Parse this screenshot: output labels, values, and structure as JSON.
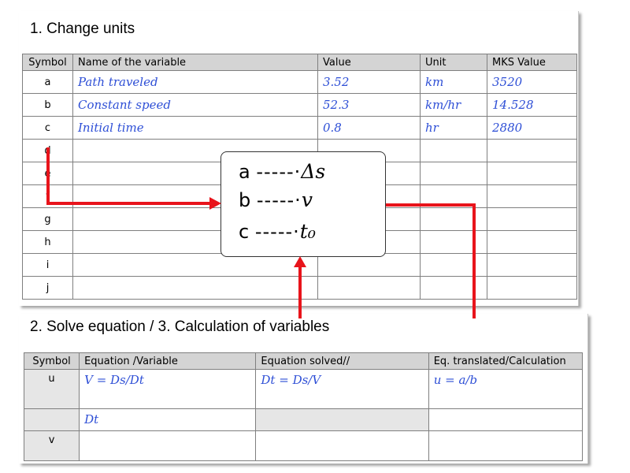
{
  "section1": {
    "title": "1. Change units",
    "headers": [
      "Symbol",
      "Name of the variable",
      "Value",
      "Unit",
      "MKS Value"
    ],
    "rows": [
      {
        "symbol": "a",
        "name": "Path traveled",
        "value": "3.52",
        "unit": "km",
        "mks": "3520"
      },
      {
        "symbol": "b",
        "name": "Constant speed",
        "value": "52.3",
        "unit": "km/hr",
        "mks": "14.528"
      },
      {
        "symbol": "c",
        "name": "Initial time",
        "value": "0.8",
        "unit": "hr",
        "mks": "2880"
      },
      {
        "symbol": "d",
        "name": "",
        "value": "",
        "unit": "",
        "mks": ""
      },
      {
        "symbol": "e",
        "name": "",
        "value": "",
        "unit": "",
        "mks": ""
      },
      {
        "symbol": "f",
        "name": "",
        "value": "",
        "unit": "",
        "mks": ""
      },
      {
        "symbol": "g",
        "name": "",
        "value": "",
        "unit": "",
        "mks": ""
      },
      {
        "symbol": "h",
        "name": "",
        "value": "",
        "unit": "",
        "mks": ""
      },
      {
        "symbol": "i",
        "name": "",
        "value": "",
        "unit": "",
        "mks": ""
      },
      {
        "symbol": "j",
        "name": "",
        "value": "",
        "unit": "",
        "mks": ""
      }
    ]
  },
  "mapping": [
    {
      "letter": "a",
      "dashes": "-----·",
      "math": "Δs"
    },
    {
      "letter": "b",
      "dashes": "-----·",
      "math": "v"
    },
    {
      "letter": "c",
      "dashes": "-----·",
      "math": "t₀"
    }
  ],
  "section2": {
    "title": "2. Solve equation / 3. Calculation of variables",
    "headers": [
      "Symbol",
      "Equation /Variable",
      "Equation solved//",
      "Eq. translated/Calculation"
    ],
    "rows": [
      {
        "symbol": "u",
        "equation": "V = Ds/Dt",
        "solved": "Dt = Ds/V",
        "translated": "u = a/b"
      },
      {
        "symbol": "",
        "equation": "Dt",
        "solved": "",
        "translated": ""
      },
      {
        "symbol": "v",
        "equation": "",
        "solved": "",
        "translated": ""
      }
    ]
  },
  "colors": {
    "arrow": "#e8141b",
    "handwriting": "#2e4fd6",
    "header_bg": "#d4d4d4"
  }
}
